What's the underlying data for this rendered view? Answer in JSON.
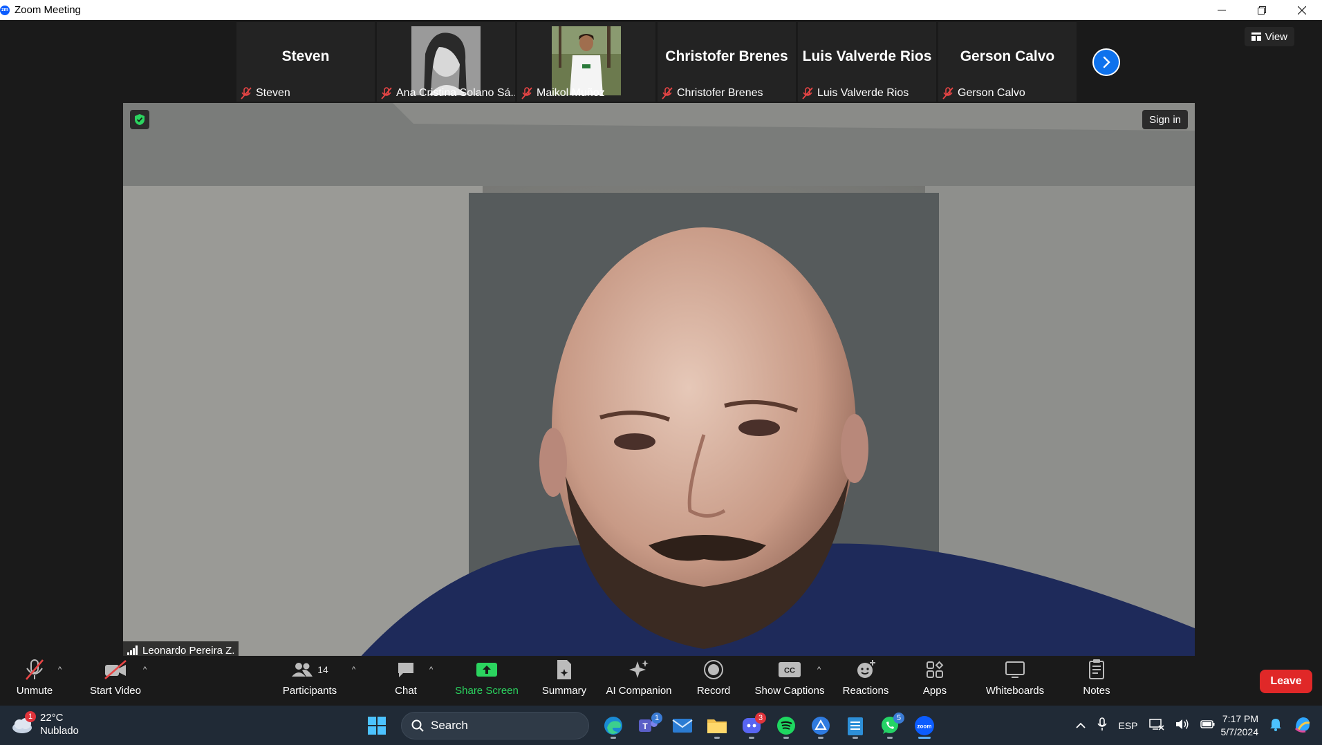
{
  "window": {
    "app_logo": "zm",
    "title": "Zoom Meeting",
    "controls": [
      "minimize-icon",
      "restore-icon",
      "close-icon"
    ]
  },
  "meeting": {
    "view_label": "View",
    "sign_in_label": "Sign in",
    "active_speaker": "Leonardo Pereira Z.",
    "thumbnails": [
      {
        "display": "Steven",
        "label": "Steven",
        "has_video": false
      },
      {
        "display": "",
        "label": "Ana Cristina Solano Sá...",
        "has_video": true
      },
      {
        "display": "",
        "label": "Maikol Muñoz",
        "has_video": true
      },
      {
        "display": "Christofer Brenes",
        "label": "Christofer Brenes",
        "has_video": false
      },
      {
        "display": "Luis Valverde Rios",
        "label": "Luis Valverde Rios",
        "has_video": false
      },
      {
        "display": "Gerson Calvo",
        "label": "Gerson Calvo",
        "has_video": false
      }
    ]
  },
  "toolbar": {
    "unmute": "Unmute",
    "start_video": "Start Video",
    "participants": "Participants",
    "participants_count": "14",
    "chat": "Chat",
    "share_screen": "Share Screen",
    "summary": "Summary",
    "ai_companion": "AI Companion",
    "record": "Record",
    "show_captions": "Show Captions",
    "captions_icon_text": "CC",
    "reactions": "Reactions",
    "apps": "Apps",
    "whiteboards": "Whiteboards",
    "notes": "Notes",
    "leave": "Leave",
    "share_color": "#2bd45f",
    "leave_color": "#e02828"
  },
  "taskbar": {
    "weather_badge": "1",
    "temperature": "22°C",
    "condition": "Nublado",
    "search_placeholder": "Search",
    "teams_badge": "1",
    "discord_badge": "3",
    "whatsapp_badge": "5",
    "zoom_text": "zoom",
    "language": "ESP",
    "time": "7:17 PM",
    "date": "5/7/2024"
  }
}
